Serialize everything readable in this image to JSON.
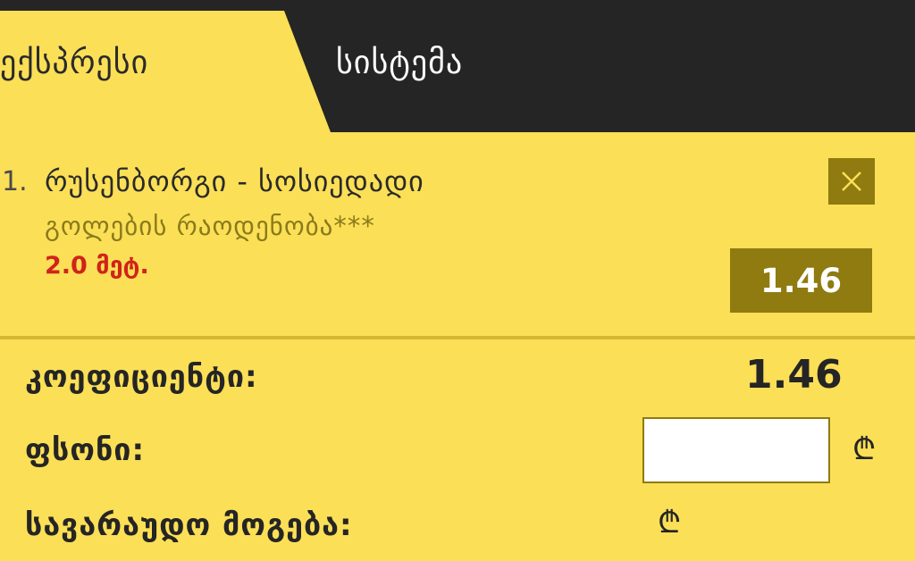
{
  "tabs": {
    "express_label": "ექსპრესი",
    "system_label": "სისტემა",
    "active": "express"
  },
  "bet": {
    "number": "1.",
    "match": "რუსენბორგი - სოსიედადი",
    "market": "გოლების რაოდენობა***",
    "pick": "2.0 მეტ.",
    "odd": "1.46",
    "close_icon": "close-icon"
  },
  "summary": {
    "coefficient_label": "კოეფიციენტი:",
    "coefficient_value": "1.46",
    "stake_label": "ფსონი:",
    "stake_value": "",
    "currency_symbol": "₾",
    "possible_win_label": "სავარაუდო მოგება:",
    "possible_win_value": ""
  },
  "colors": {
    "background": "#fbdf56",
    "dark": "#252525",
    "accent": "#8f7b10",
    "pick": "#d0231a"
  }
}
